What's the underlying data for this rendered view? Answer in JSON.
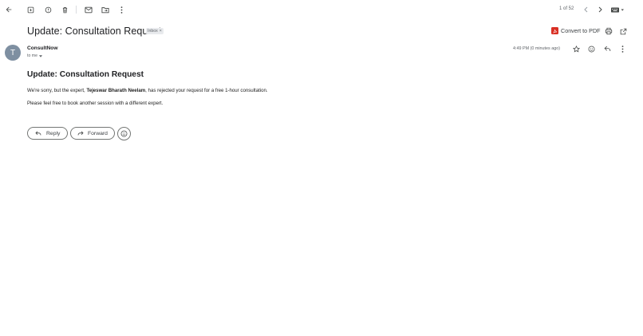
{
  "toolbar": {
    "pager_text": "1 of 52",
    "icons": [
      "back-arrow-icon",
      "archive-icon",
      "report-spam-icon",
      "delete-icon",
      "mark-unread-icon",
      "move-to-icon",
      "more-vert-icon"
    ]
  },
  "message": {
    "subject": "Update: Consultation Request",
    "label": "Inbox",
    "label_close": "×",
    "convert_pdf_label": "Convert to PDF",
    "avatar_letter": "T",
    "sender_name": "ConsultNow",
    "recipient_text": "to me",
    "timestamp": "4:49 PM (0 minutes ago)",
    "heading": "Update: Consultation Request",
    "para1_before": "We're sorry, but the expert, ",
    "para1_expert": "Tejeswar Bharath Neelam",
    "para1_after": ", has rejected your request for a free 1-hour consultation.",
    "para2": "Please feel free to book another session with a different expert."
  },
  "actions": {
    "reply_label": "Reply",
    "forward_label": "Forward"
  },
  "colors": {
    "pdf_red": "#d93025",
    "avatar_bg": "#7e8fa1",
    "label_bg": "#e8eaed"
  }
}
